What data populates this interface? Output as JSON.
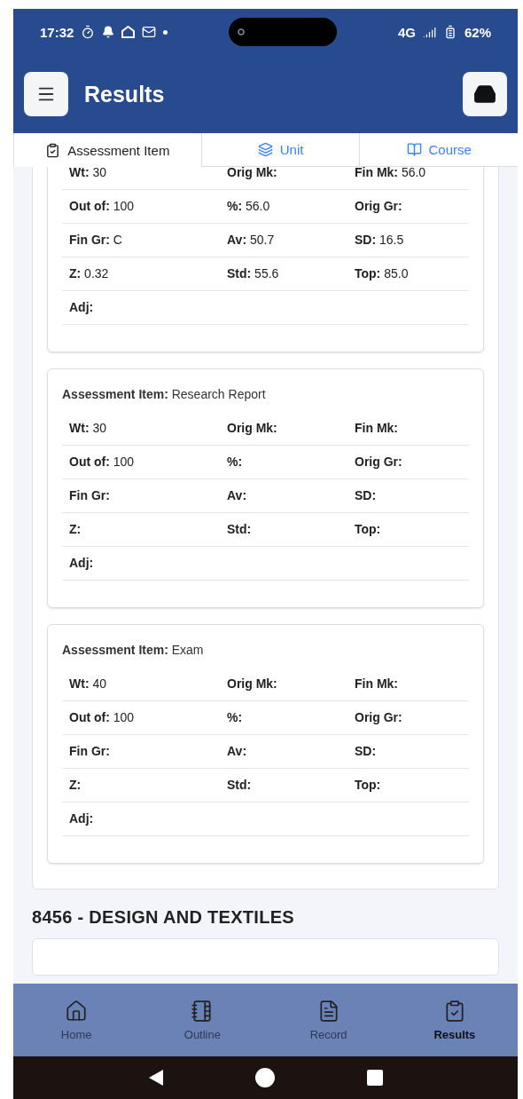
{
  "status_bar": {
    "time": "17:32",
    "network": "4G",
    "battery": "62%"
  },
  "header": {
    "title": "Results"
  },
  "tabs": [
    {
      "label": "Assessment Item",
      "selected": true
    },
    {
      "label": "Unit",
      "selected": false
    },
    {
      "label": "Course",
      "selected": false
    }
  ],
  "cards": [
    {
      "fields": [
        {
          "label": "Wt:",
          "value": "30"
        },
        {
          "label": "Orig Mk:"
        },
        {
          "label": "Fin Mk:",
          "value": "56.0"
        },
        {
          "label": "Out of:",
          "value": "100"
        },
        {
          "label": "%:",
          "value": "56.0"
        },
        {
          "label": "Orig Gr:"
        },
        {
          "label": "Fin Gr:",
          "value": "C"
        },
        {
          "label": "Av:",
          "value": "50.7"
        },
        {
          "label": "SD:",
          "value": "16.5"
        },
        {
          "label": "Z:",
          "value": "0.32"
        },
        {
          "label": "Std:",
          "value": "55.6"
        },
        {
          "label": "Top:",
          "value": "85.0"
        },
        {
          "label": "Adj:"
        }
      ]
    },
    {
      "title_label": "Assessment Item:",
      "title_value": "Research Report",
      "fields": [
        {
          "label": "Wt:",
          "value": "30"
        },
        {
          "label": "Orig Mk:"
        },
        {
          "label": "Fin Mk:"
        },
        {
          "label": "Out of:",
          "value": "100"
        },
        {
          "label": "%:"
        },
        {
          "label": "Orig Gr:"
        },
        {
          "label": "Fin Gr:"
        },
        {
          "label": "Av:"
        },
        {
          "label": "SD:"
        },
        {
          "label": "Z:"
        },
        {
          "label": "Std:"
        },
        {
          "label": "Top:"
        },
        {
          "label": "Adj:"
        }
      ]
    },
    {
      "title_label": "Assessment Item:",
      "title_value": "Exam",
      "fields": [
        {
          "label": "Wt:",
          "value": "40"
        },
        {
          "label": "Orig Mk:"
        },
        {
          "label": "Fin Mk:"
        },
        {
          "label": "Out of:",
          "value": "100"
        },
        {
          "label": "%:"
        },
        {
          "label": "Orig Gr:"
        },
        {
          "label": "Fin Gr:"
        },
        {
          "label": "Av:"
        },
        {
          "label": "SD:"
        },
        {
          "label": "Z:"
        },
        {
          "label": "Std:"
        },
        {
          "label": "Top:"
        },
        {
          "label": "Adj:"
        }
      ]
    }
  ],
  "next_course": {
    "heading": "8456 - DESIGN AND TEXTILES"
  },
  "bottom_nav": [
    {
      "label": "Home",
      "selected": false
    },
    {
      "label": "Outline",
      "selected": false
    },
    {
      "label": "Record",
      "selected": false
    },
    {
      "label": "Results",
      "selected": true
    }
  ]
}
